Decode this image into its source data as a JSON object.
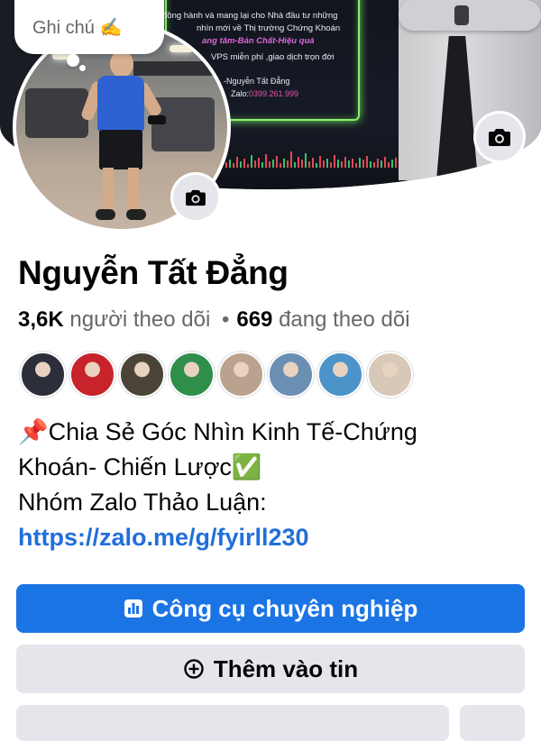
{
  "cover": {
    "lines": [
      "đồng hành và mang lại cho Nhà đầu tư những",
      "nhìn mới về Thị trường Chứng Khoán",
      "ang tâm-Bản Chất-Hiệu quả",
      "VPS miễn phí ,giao dịch trọn đời",
      "-Nguyễn Tất Đẳng",
      "Zalo:",
      "0399.261.999"
    ]
  },
  "note": {
    "text": "Ghi chú ✍️"
  },
  "profile": {
    "name": "Nguyễn Tất Đẳng",
    "followers_count": "3,6K",
    "followers_label": "người theo dõi",
    "following_count": "669",
    "following_label": "đang theo dõi",
    "separator": "•"
  },
  "friends": {
    "avatar_colors": [
      "#2c2f3a",
      "#c8232b",
      "#4a4438",
      "#2f8f4a",
      "#b9a28e",
      "#6a8fb3",
      "#4b93c9",
      "#d8c8b8"
    ]
  },
  "bio": {
    "line1": "📌Chia Sẻ Góc Nhìn Kinh Tế-Chứng",
    "line2": "Khoán- Chiến Lược✅",
    "line3": "Nhóm Zalo Thảo Luận:",
    "link": "https://zalo.me/g/fyirll230"
  },
  "buttons": {
    "professional_tools": "Công cụ chuyên nghiệp",
    "add_to_story": "Thêm vào tin"
  },
  "colors": {
    "primary": "#1b74e4",
    "link": "#216fdb",
    "secondary_bg": "#e4e6eb"
  },
  "icons": [
    "camera-icon",
    "chart-bar-icon",
    "plus-circle-icon"
  ]
}
